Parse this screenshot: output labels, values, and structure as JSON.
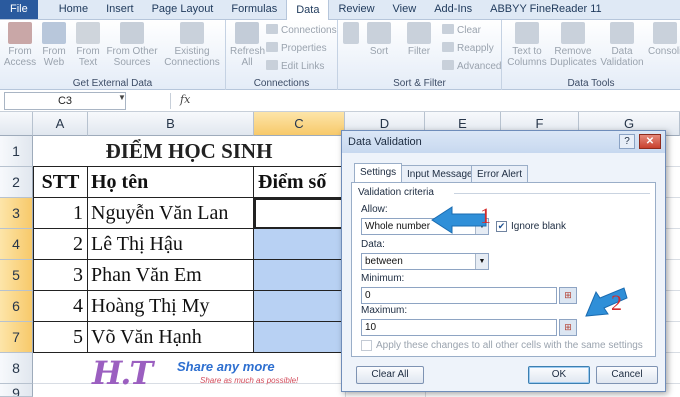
{
  "ribbon": {
    "tabs": [
      "File",
      "Home",
      "Insert",
      "Page Layout",
      "Formulas",
      "Data",
      "Review",
      "View",
      "Add-Ins",
      "ABBYY FineReader 11"
    ],
    "active_tab": "Data",
    "groups": {
      "external": {
        "label": "Get External Data",
        "buttons": [
          "From Access",
          "From Web",
          "From Text",
          "From Other Sources"
        ],
        "existing": "Existing Connections"
      },
      "connections": {
        "label": "Connections",
        "refresh": "Refresh All",
        "items": [
          "Connections",
          "Properties",
          "Edit Links"
        ]
      },
      "sort": {
        "label": "Sort & Filter",
        "sort": "Sort",
        "filter": "Filter",
        "items": [
          "Clear",
          "Reapply",
          "Advanced"
        ]
      },
      "tools": {
        "label": "Data Tools",
        "buttons": [
          "Text to Columns",
          "Remove Duplicates",
          "Data Validation",
          "Consolidate"
        ]
      }
    }
  },
  "formula_bar": {
    "name_box": "C3",
    "fx": "fx",
    "value": ""
  },
  "sheet": {
    "columns": [
      "A",
      "B",
      "C",
      "D",
      "E",
      "F",
      "G"
    ],
    "selected_column": "C",
    "rows": [
      "1",
      "2",
      "3",
      "4",
      "5",
      "6",
      "7",
      "8",
      "9"
    ],
    "selected_rows": [
      "3",
      "4",
      "5",
      "6",
      "7"
    ],
    "title": "ĐIỂM HỌC SINH",
    "headers": {
      "stt": "STT",
      "name": "Họ tên",
      "score": "Điểm số"
    },
    "students": [
      {
        "stt": "1",
        "name": "Nguyễn Văn Lan"
      },
      {
        "stt": "2",
        "name": "Lê Thị Hậu"
      },
      {
        "stt": "3",
        "name": "Phan Văn Em"
      },
      {
        "stt": "4",
        "name": "Hoàng Thị My"
      },
      {
        "stt": "5",
        "name": "Võ Văn Hạnh"
      }
    ]
  },
  "logo": {
    "mark": "H.T",
    "tagline": "Share any more",
    "sub": "Share as much as possible!"
  },
  "dialog": {
    "title": "Data Validation",
    "tabs": [
      "Settings",
      "Input Message",
      "Error Alert"
    ],
    "active_tab": "Settings",
    "criteria_label": "Validation criteria",
    "allow_label": "Allow:",
    "allow_value": "Whole number",
    "ignore_blank_label": "Ignore blank",
    "ignore_blank_checked": true,
    "data_label": "Data:",
    "data_value": "between",
    "minimum_label": "Minimum:",
    "minimum_value": "0",
    "maximum_label": "Maximum:",
    "maximum_value": "10",
    "apply_label": "Apply these changes to all other cells with the same settings",
    "apply_checked": false,
    "clear_all": "Clear All",
    "ok": "OK",
    "cancel": "Cancel"
  },
  "annotations": {
    "arrow1_number": "1",
    "arrow2_number": "2",
    "arrow_color": "#2f8fd8",
    "number_color": "#d42a2a"
  }
}
